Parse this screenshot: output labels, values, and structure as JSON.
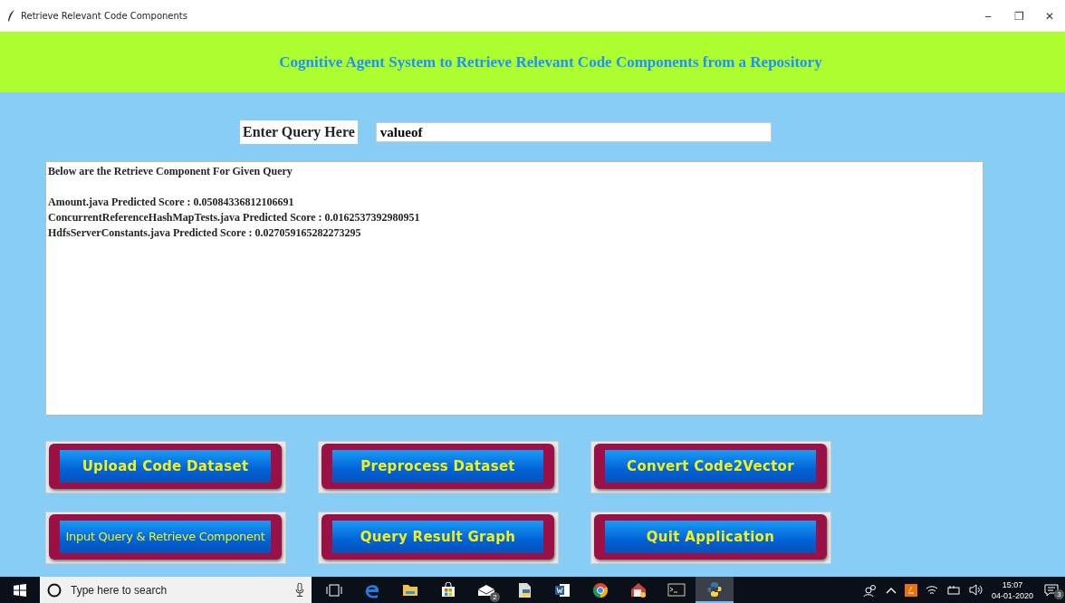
{
  "window": {
    "title": "Retrieve Relevant Code Components",
    "controls": [
      "–",
      "❐",
      "✕"
    ]
  },
  "header": {
    "title": "Cognitive Agent System to Retrieve Relevant Code Components from a Repository"
  },
  "query": {
    "label": "Enter Query Here",
    "value": "valueof"
  },
  "output": {
    "heading": "Below are the Retrieve Component For Given Query",
    "lines": [
      "Amount.java Predicted Score : 0.05084336812106691",
      "ConcurrentReferenceHashMapTests.java Predicted Score : 0.0162537392980951",
      "HdfsServerConstants.java Predicted Score : 0.027059165282273295"
    ]
  },
  "buttons": [
    {
      "label": "Upload Code Dataset",
      "small": false
    },
    {
      "label": "Preprocess Dataset",
      "small": false
    },
    {
      "label": "Convert Code2Vector",
      "small": false
    },
    {
      "label": "Input Query & Retrieve Component",
      "small": true
    },
    {
      "label": "Query Result Graph",
      "small": false
    },
    {
      "label": "Quit Application",
      "small": false
    }
  ],
  "taskbar": {
    "search": {
      "placeholder": "Type here to search"
    },
    "apps": [
      {
        "kind": "taskview",
        "selected": false
      },
      {
        "kind": "edge",
        "selected": false
      },
      {
        "kind": "folder",
        "selected": false
      },
      {
        "kind": "store",
        "selected": false
      },
      {
        "kind": "mail",
        "selected": false,
        "badge": "2"
      },
      {
        "kind": "python-file",
        "selected": false
      },
      {
        "kind": "word",
        "selected": false
      },
      {
        "kind": "chrome",
        "selected": false
      },
      {
        "kind": "app",
        "selected": false
      },
      {
        "kind": "terminal",
        "selected": false
      },
      {
        "kind": "python",
        "selected": true
      }
    ],
    "time": "15:07",
    "date": "04-01-2020",
    "notifications": "3"
  }
}
